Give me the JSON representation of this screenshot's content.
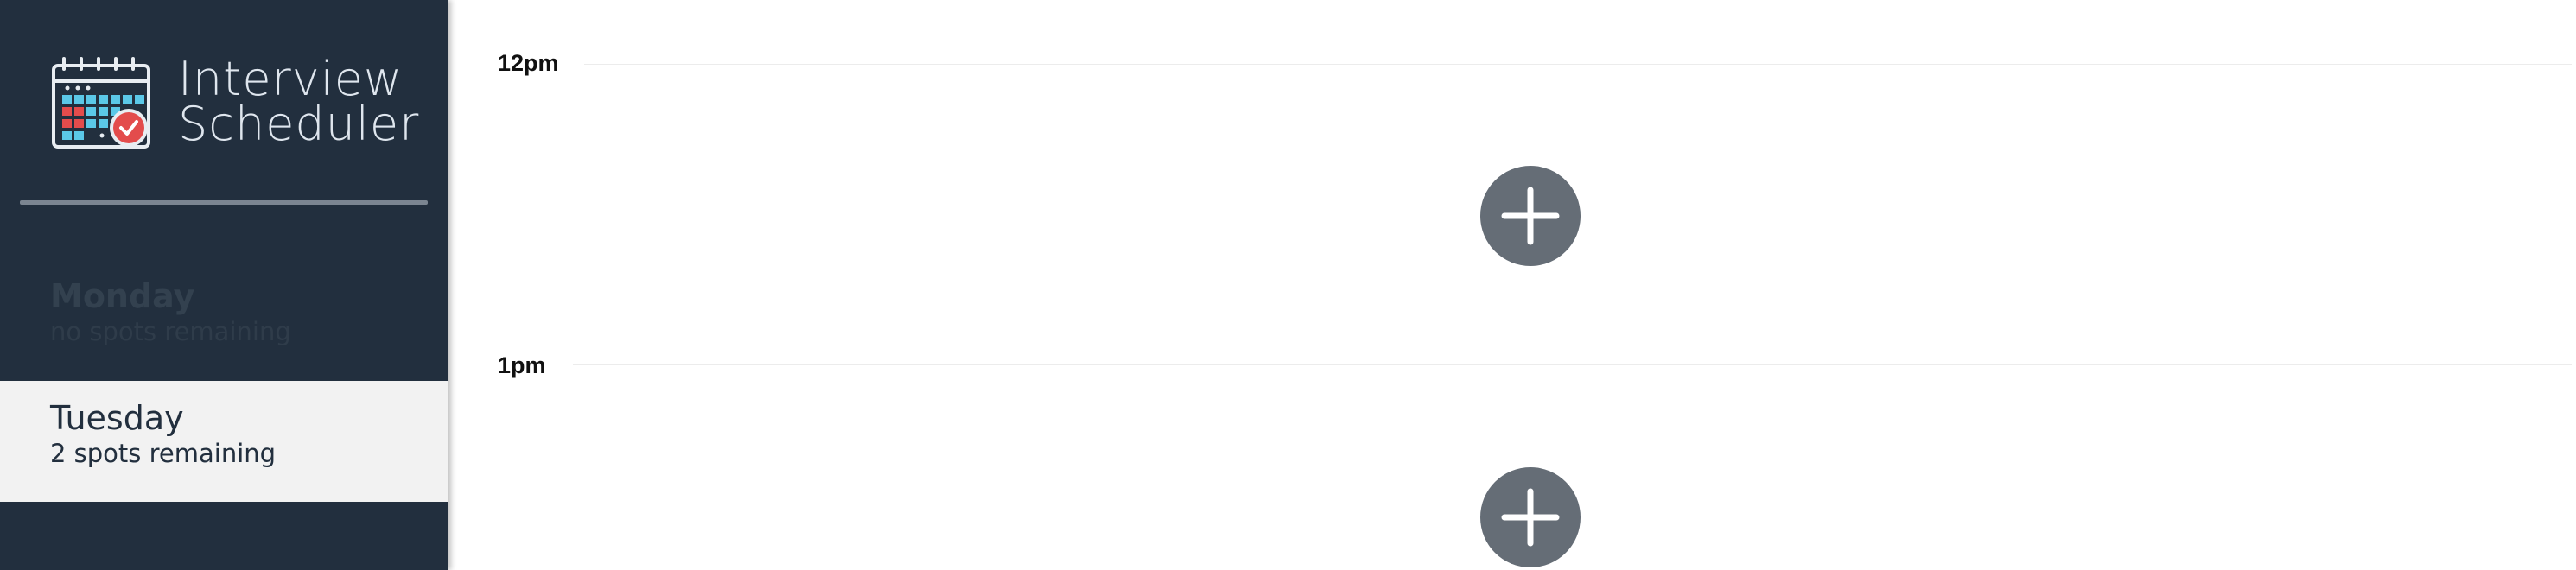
{
  "brand": {
    "title_line1": "Interview",
    "title_line2": "Scheduler",
    "logo_icon": "calendar-check-icon"
  },
  "colors": {
    "sidebar_bg": "#222f3e",
    "selected_day_bg": "#f2f2f2",
    "add_button_bg": "#656d76",
    "logo_check_red": "#e34c4c",
    "logo_cell_blue": "#5bc8e8"
  },
  "days": [
    {
      "name": "Monday",
      "spots": "no spots remaining",
      "state": "full"
    },
    {
      "name": "Tuesday",
      "spots": "2 spots remaining",
      "state": "selected"
    }
  ],
  "schedule": {
    "slots": [
      {
        "time": "12pm",
        "action_icon": "add-icon"
      },
      {
        "time": "1pm",
        "action_icon": "add-icon"
      }
    ]
  }
}
